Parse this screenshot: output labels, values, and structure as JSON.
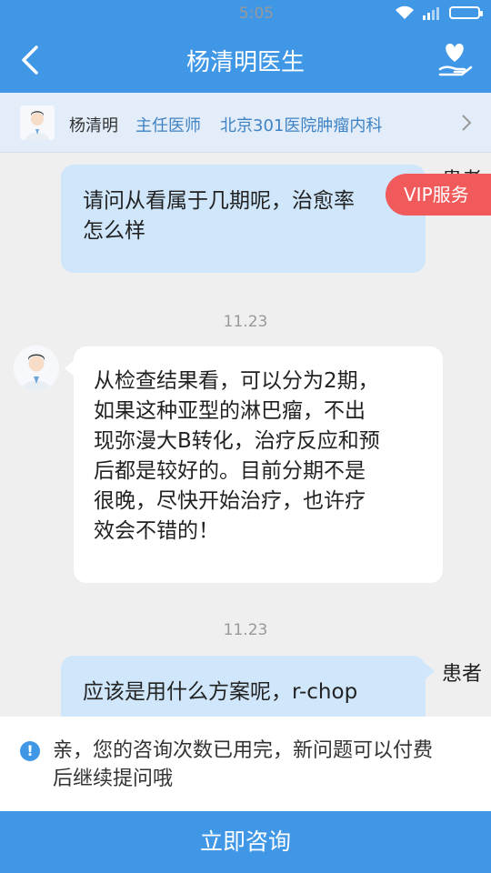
{
  "status_bar": {
    "time": "5:05"
  },
  "header": {
    "title": "杨清明医生"
  },
  "doctor_bar": {
    "name": "杨清明",
    "rank": "主任医师",
    "hospital": "北京301医院肿瘤内科"
  },
  "chat": {
    "messages": [
      {
        "from": "patient",
        "sender_label": "患者",
        "lines": [
          "请问从看属于几期呢，治愈率",
          "怎么样"
        ]
      },
      {
        "timestamp": "11.23"
      },
      {
        "from": "doctor",
        "lines": [
          "从检查结果看，可以分为2期，",
          "如果这种亚型的淋巴瘤，不出",
          "现弥漫大B转化，治疗反应和预",
          "后都是较好的。目前分期不是",
          "很晚，尽快开始治疗，也许疗",
          "效会不错的！"
        ]
      },
      {
        "timestamp": "11.23"
      },
      {
        "from": "patient",
        "sender_label": "患者",
        "lines": [
          "应该是用什么方案呢，r-chop"
        ]
      }
    ]
  },
  "vip_badge": {
    "label": "VIP服务"
  },
  "notice": {
    "icon": "info-icon",
    "text_line1": "亲，您的咨询次数已用完，新问题可以付费",
    "text_line2": "后继续提问哦"
  },
  "consult_button": {
    "label": "立即咨询"
  },
  "colors": {
    "primary": "#3f97e6",
    "vip": "#f05a5a",
    "patient_bubble": "#cfe6fb",
    "doctor_bubble": "#ffffff"
  }
}
